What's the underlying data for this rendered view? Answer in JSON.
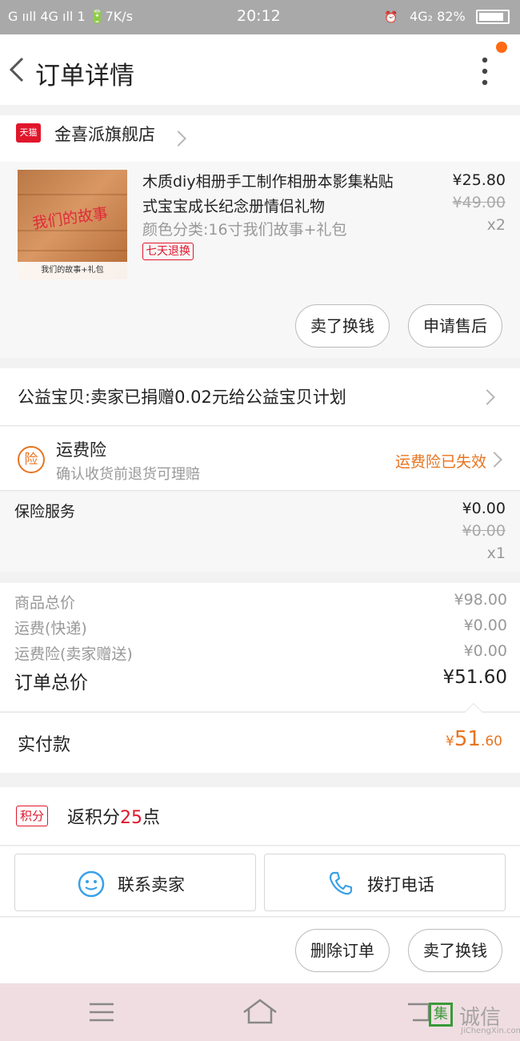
{
  "status_bar": {
    "left": "G ııll 4G ıll 1 🔋7K/s",
    "time": "20:12",
    "right": "4G₂ 82%"
  },
  "nav": {
    "title": "订单详情"
  },
  "store": {
    "badge": "天猫",
    "name": "金喜派旗舰店"
  },
  "product": {
    "title": "木质diy相册手工制作相册本影集粘贴式宝宝成长纪念册情侣礼物",
    "spec": "颜色分类:16寸我们故事+礼包",
    "badge": "七天退换",
    "price": "¥25.80",
    "original_price": "¥49.00",
    "quantity": "x2",
    "image_text": "我们的故事",
    "image_caption": "我们的故事+礼包",
    "buttons": {
      "sell": "卖了换钱",
      "after_sale": "申请售后"
    }
  },
  "charity": {
    "text": "公益宝贝:卖家已捐赠0.02元给公益宝贝计划"
  },
  "insurance": {
    "icon_label": "险",
    "title": "运费险",
    "subtitle": "确认收货前退货可理赔",
    "status": "运费险已失效"
  },
  "service": {
    "name": "保险服务",
    "price": "¥0.00",
    "original_price": "¥0.00",
    "quantity": "x1"
  },
  "summary": {
    "goods_label": "商品总价",
    "goods_value": "¥98.00",
    "shipping_label": "运费(快递)",
    "shipping_value": "¥0.00",
    "insurance_label": "运费险(卖家赠送)",
    "insurance_value": "¥0.00",
    "total_label": "订单总价",
    "total_value": "¥51.60"
  },
  "paid": {
    "label": "实付款",
    "currency": "¥",
    "integer": "51",
    "decimal": ".60"
  },
  "points": {
    "badge": "积分",
    "prefix": "返积分",
    "amount": "25",
    "suffix": "点"
  },
  "contact": {
    "seller": "联系卖家",
    "call": "拨打电话"
  },
  "actions": {
    "delete": "删除订单",
    "sell": "卖了换钱"
  },
  "watermark": {
    "mark": "集",
    "text": "诚信",
    "url": "JiChengXin.com"
  },
  "colors": {
    "accent_orange": "#e8741f",
    "tmall_red": "#e0162b",
    "icon_blue": "#3aa0e8"
  }
}
